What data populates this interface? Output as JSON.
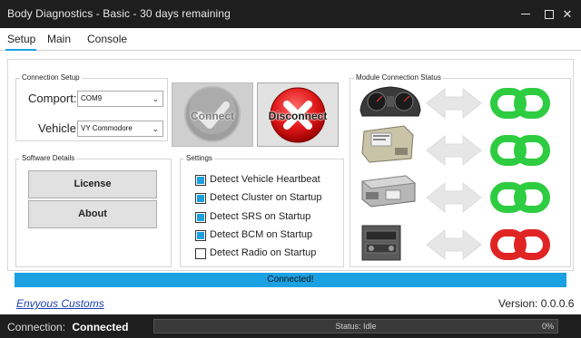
{
  "window": {
    "title": "Body Diagnostics - Basic - 30 days remaining"
  },
  "tabs": [
    {
      "label": "Setup"
    },
    {
      "label": "Main"
    },
    {
      "label": "Console"
    }
  ],
  "connection_setup": {
    "legend": "Connection Setup",
    "comport_label": "Comport:",
    "comport_value": "COM9",
    "vehicle_label": "Vehicle:",
    "vehicle_value": "VY Commodore"
  },
  "buttons": {
    "connect": "Connect",
    "disconnect": "Disconnect"
  },
  "software_details": {
    "legend": "Software Details",
    "license": "License",
    "about": "About"
  },
  "settings": {
    "legend": "Settings",
    "items": [
      {
        "label": "Detect Vehicle Heartbeat",
        "checked": true
      },
      {
        "label": "Detect Cluster on Startup",
        "checked": true
      },
      {
        "label": "Detect SRS on Startup",
        "checked": true
      },
      {
        "label": "Detect BCM on Startup",
        "checked": true
      },
      {
        "label": "Detect Radio on Startup",
        "checked": false
      }
    ]
  },
  "module_status": {
    "legend": "Module Connection Status",
    "modules": [
      {
        "icon": "instrument-cluster-icon",
        "status": "connected"
      },
      {
        "icon": "srs-module-icon",
        "status": "connected"
      },
      {
        "icon": "bcm-module-icon",
        "status": "connected"
      },
      {
        "icon": "radio-unit-icon",
        "status": "disconnected"
      }
    ],
    "colors": {
      "connected": "#2ecc40",
      "disconnected": "#e02424"
    }
  },
  "progress": {
    "text": "Connected!"
  },
  "footer": {
    "link": "Envyous Customs",
    "version": "Version: 0.0.0.6"
  },
  "statusbar": {
    "connection_label": "Connection:",
    "connection_value": "Connected",
    "status": "Status: Idle",
    "percent": "0%"
  },
  "colors": {
    "accent": "#1ba1e2",
    "titlebar": "#1e1e1e"
  }
}
